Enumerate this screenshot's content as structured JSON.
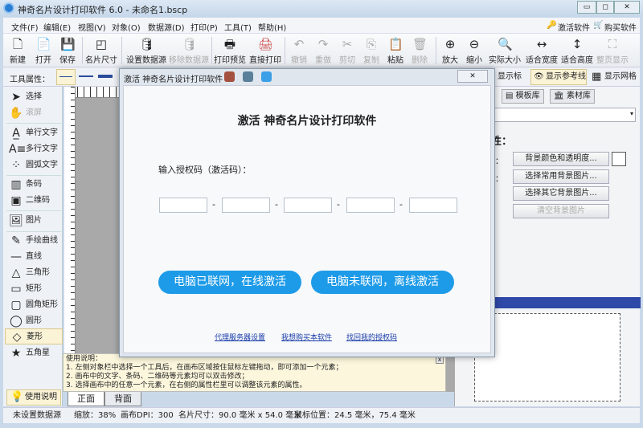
{
  "window": {
    "title": "神奇名片设计打印软件 6.0 - 未命名1.bscp",
    "min": "▭",
    "max": "◻",
    "close": "✕"
  },
  "menu": [
    "文件(F)",
    "编辑(E)",
    "视图(V)",
    "对象(O)",
    "数据源(D)",
    "打印(P)",
    "工具(T)",
    "帮助(H)"
  ],
  "menu_right": {
    "activate": "激活软件",
    "buy": "购买软件"
  },
  "toolbar": [
    "新建",
    "打开",
    "保存",
    "名片尺寸",
    "设置数据源",
    "移除数据源",
    "打印预览",
    "直接打印",
    "撤销",
    "重做",
    "剪切",
    "复制",
    "粘贴",
    "删除",
    "放大",
    "缩小",
    "实际大小",
    "适合宽度",
    "适合高度",
    "整页显示"
  ],
  "propbar": {
    "label": "工具属性：",
    "show_ruler": "显示标尺",
    "show_guides": "显示参考线",
    "show_grid": "显示网格"
  },
  "tools": [
    "选择",
    "滚屏",
    "单行文字",
    "多行文字",
    "圆弧文字",
    "条码",
    "二维码",
    "图片",
    "手绘曲线",
    "直线",
    "三角形",
    "矩形",
    "圆角矩形",
    "圆形",
    "菱形",
    "五角星"
  ],
  "help": {
    "title": "使用说明：",
    "lines": [
      "1. 左侧对象栏中选择一个工具后，在画布区域按住鼠标左键拖动，即可添加一个元素；",
      "2. 画布中的文字、条码、二维码等元素均可以双击修改；",
      "3. 选择画布中的任意一个元素，在右侧的属性栏里可以调整该元素的属性。"
    ],
    "close": "x",
    "button": "使用说明"
  },
  "page_tabs": [
    "正面",
    "背面"
  ],
  "status": {
    "datasource": "未设置数据源",
    "zoom": "缩放：38%",
    "dpi": "画布DPI：300",
    "size": "名片尺寸：90.0 毫米 x 54.0 毫米",
    "mouse": "鼠标位置：24.5 毫米，75.4 毫米"
  },
  "right": {
    "tabs": [
      "模板库",
      "素材库"
    ],
    "section": "背景属性：",
    "color_label": "背景颜色：",
    "image_label": "背景图片：",
    "buttons": [
      "背景颜色和透明度...",
      "选择常用背景图片...",
      "选择其它背景图片...",
      "清空背景图片"
    ]
  },
  "dialog": {
    "title": "激活 神奇名片设计打印软件",
    "heading": "激活 神奇名片设计打印软件",
    "prompt": "输入授权码（激活码）：",
    "codes": [
      "",
      "",
      "",
      "",
      ""
    ],
    "online": "电脑已联网，在线激活",
    "offline": "电脑未联网，离线激活",
    "links": [
      "代理服务器设置",
      "我想购买本软件",
      "找回我的授权码"
    ],
    "close": "✕"
  },
  "colors": {
    "accent": "#1e9be8",
    "link": "#1a3caa"
  }
}
